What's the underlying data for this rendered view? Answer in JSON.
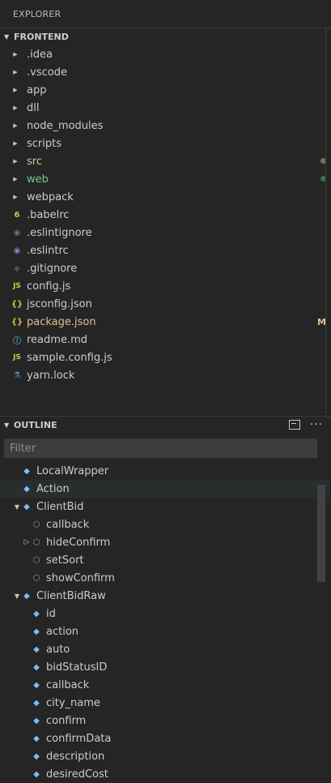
{
  "explorer": {
    "title": "EXPLORER"
  },
  "frontend": {
    "header": "FRONTEND",
    "items": [
      {
        "label": ".idea",
        "kind": "folder",
        "color": "#cccccc"
      },
      {
        "label": ".vscode",
        "kind": "folder",
        "color": "#cccccc"
      },
      {
        "label": "app",
        "kind": "folder",
        "color": "#cccccc"
      },
      {
        "label": "dll",
        "kind": "folder",
        "color": "#cccccc"
      },
      {
        "label": "node_modules",
        "kind": "folder",
        "color": "#cccccc"
      },
      {
        "label": "scripts",
        "kind": "folder",
        "color": "#cccccc"
      },
      {
        "label": "src",
        "kind": "folder",
        "color": "#e2c08d",
        "dot": "#7c6f55"
      },
      {
        "label": "web",
        "kind": "folder",
        "color": "#73c991",
        "dot": "#3e6f4c"
      },
      {
        "label": "webpack",
        "kind": "folder",
        "color": "#cccccc"
      },
      {
        "label": ".babelrc",
        "kind": "file",
        "icon": "babel-icon",
        "glyph": "6",
        "iconColor": "#cbcb41",
        "color": "#cccccc"
      },
      {
        "label": ".eslintignore",
        "kind": "file",
        "icon": "eslint-ignore-icon",
        "glyph": "◉",
        "iconColor": "#6d6d6d",
        "color": "#cccccc"
      },
      {
        "label": ".eslintrc",
        "kind": "file",
        "icon": "eslint-icon",
        "glyph": "◉",
        "iconColor": "#a074c4",
        "color": "#cccccc"
      },
      {
        "label": ".gitignore",
        "kind": "file",
        "icon": "git-icon",
        "glyph": "◆",
        "iconColor": "#41535b",
        "color": "#cccccc"
      },
      {
        "label": "config.js",
        "kind": "file",
        "icon": "js-icon",
        "glyph": "JS",
        "iconColor": "#cbcb41",
        "color": "#cccccc"
      },
      {
        "label": "jsconfig.json",
        "kind": "file",
        "icon": "json-icon",
        "glyph": "{}",
        "iconColor": "#cbcb41",
        "color": "#cccccc"
      },
      {
        "label": "package.json",
        "kind": "file",
        "icon": "json-icon",
        "glyph": "{}",
        "iconColor": "#cbcb41",
        "color": "#e2c08d",
        "badge": "M"
      },
      {
        "label": "readme.md",
        "kind": "file",
        "icon": "info-icon",
        "glyph": "ⓘ",
        "iconColor": "#519aba",
        "color": "#cccccc"
      },
      {
        "label": "sample.config.js",
        "kind": "file",
        "icon": "js-icon",
        "glyph": "JS",
        "iconColor": "#cbcb41",
        "color": "#cccccc"
      },
      {
        "label": "yarn.lock",
        "kind": "file",
        "icon": "yarn-icon",
        "glyph": "⚗",
        "iconColor": "#519aba",
        "color": "#cccccc"
      }
    ]
  },
  "outline": {
    "header": "OUTLINE",
    "filter_placeholder": "Filter",
    "items": [
      {
        "label": "LocalWrapper",
        "level": 1,
        "type": "class",
        "twisty": ""
      },
      {
        "label": "Action",
        "level": 1,
        "type": "class",
        "twisty": "",
        "selected": true
      },
      {
        "label": "ClientBid",
        "level": 1,
        "type": "class",
        "twisty": "▼"
      },
      {
        "label": "callback",
        "level": 2,
        "type": "method",
        "twisty": ""
      },
      {
        "label": "hideConfirm",
        "level": 2,
        "type": "method",
        "twisty": "▷"
      },
      {
        "label": "setSort",
        "level": 2,
        "type": "method",
        "twisty": ""
      },
      {
        "label": "showConfirm",
        "level": 2,
        "type": "method",
        "twisty": ""
      },
      {
        "label": "ClientBidRaw",
        "level": 1,
        "type": "class",
        "twisty": "▼"
      },
      {
        "label": "id",
        "level": 2,
        "type": "field",
        "twisty": ""
      },
      {
        "label": "action",
        "level": 2,
        "type": "field",
        "twisty": ""
      },
      {
        "label": "auto",
        "level": 2,
        "type": "field",
        "twisty": ""
      },
      {
        "label": "bidStatusID",
        "level": 2,
        "type": "field",
        "twisty": ""
      },
      {
        "label": "callback",
        "level": 2,
        "type": "field",
        "twisty": ""
      },
      {
        "label": "city_name",
        "level": 2,
        "type": "field",
        "twisty": ""
      },
      {
        "label": "confirm",
        "level": 2,
        "type": "field",
        "twisty": ""
      },
      {
        "label": "confirmData",
        "level": 2,
        "type": "field",
        "twisty": ""
      },
      {
        "label": "description",
        "level": 2,
        "type": "field",
        "twisty": ""
      },
      {
        "label": "desiredCost",
        "level": 2,
        "type": "field",
        "twisty": ""
      }
    ]
  }
}
